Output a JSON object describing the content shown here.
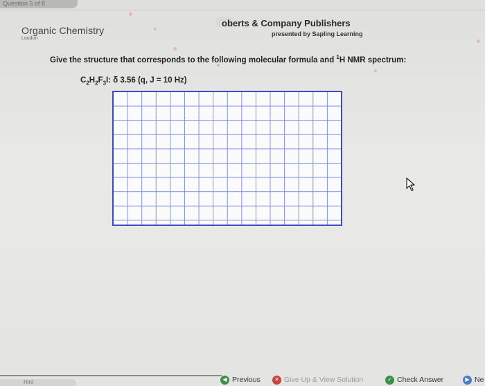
{
  "question_tab": {
    "label": "Question 5 of 8"
  },
  "course": {
    "title": "Organic Chemistry",
    "subtitle": "Loudon"
  },
  "publisher": {
    "name": "oberts & Company Publishers",
    "sub": "presented by Sapling Learning"
  },
  "question": {
    "prompt_before": "Give the structure that corresponds to the following molecular formula and ",
    "nmr_superscript": "1",
    "prompt_after": "H NMR spectrum:",
    "formula_c": "C",
    "formula_c_count": "2",
    "formula_h": "H",
    "formula_h_count": "2",
    "formula_f": "F",
    "formula_f_count": "3",
    "formula_rest": "I: δ 3.56 (q, J = 10 Hz)"
  },
  "footer": {
    "hint_label": "Hint",
    "previous_label": "Previous",
    "giveup_label": "Give Up & View Solution",
    "check_label": "Check Answer",
    "next_label": "Ne"
  },
  "icons": {
    "previous": "arrow-left-icon",
    "giveup": "close-icon",
    "check": "check-icon",
    "next": "arrow-right-icon",
    "cursor": "pointer-cursor-icon"
  },
  "colors": {
    "grid_border": "#3a4cc0",
    "grid_lines": "#7f8fe0",
    "previous_icon": "#3d8f4a",
    "giveup_icon": "#c9413d",
    "check_icon": "#3d8f4a",
    "next_icon": "#4a7fc4"
  }
}
